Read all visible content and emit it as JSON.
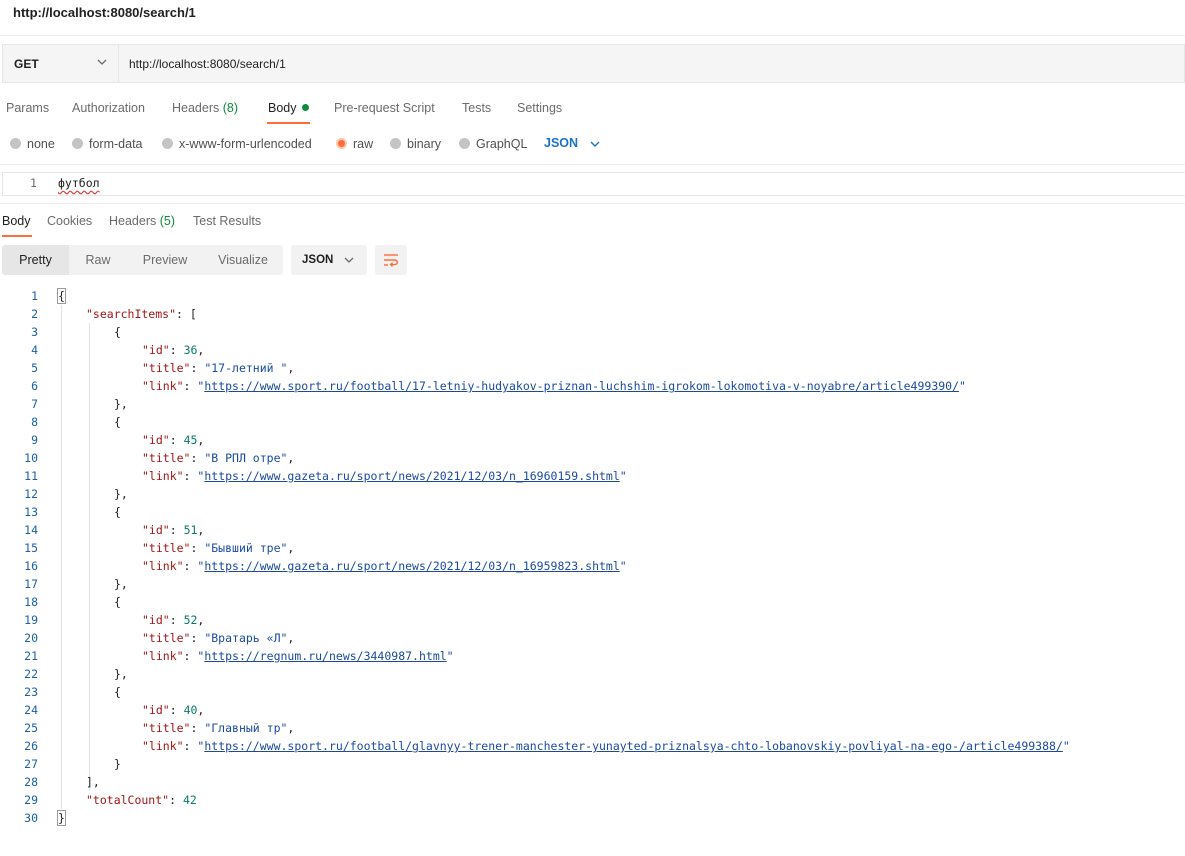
{
  "request": {
    "title": "http://localhost:8080/search/1",
    "method": "GET",
    "url": "http://localhost:8080/search/1"
  },
  "request_tabs": {
    "params": "Params",
    "authorization": "Authorization",
    "headers_label": "Headers",
    "headers_count": "(8)",
    "body": "Body",
    "pre_request": "Pre-request Script",
    "tests": "Tests",
    "settings": "Settings"
  },
  "body_types": {
    "none": "none",
    "form_data": "form-data",
    "urlencoded": "x-www-form-urlencoded",
    "raw": "raw",
    "binary": "binary",
    "graphql": "GraphQL",
    "selected_format": "JSON"
  },
  "request_body": {
    "line_number": "1",
    "text": "футбол"
  },
  "response_tabs": {
    "body": "Body",
    "cookies": "Cookies",
    "headers_label": "Headers",
    "headers_count": "(5)",
    "test_results": "Test Results"
  },
  "view_modes": {
    "pretty": "Pretty",
    "raw": "Raw",
    "preview": "Preview",
    "visualize": "Visualize",
    "format": "JSON"
  },
  "response": {
    "items": [
      {
        "id": "36",
        "title": "17-летний ",
        "link": "https://www.sport.ru/football/17-letniy-hudyakov-priznan-luchshim-igrokom-lokomotiva-v-noyabre/article499390/"
      },
      {
        "id": "45",
        "title": "В РПЛ отре",
        "link": "https://www.gazeta.ru/sport/news/2021/12/03/n_16960159.shtml"
      },
      {
        "id": "51",
        "title": "Бывший тре",
        "link": "https://www.gazeta.ru/sport/news/2021/12/03/n_16959823.shtml"
      },
      {
        "id": "52",
        "title": "Вратарь «Л",
        "link": "https://regnum.ru/news/3440987.html"
      },
      {
        "id": "40",
        "title": "Главный тр",
        "link": "https://www.sport.ru/football/glavnyy-trener-manchester-yunayted-priznalsya-chto-lobanovskiy-povliyal-na-ego-/article499388/"
      }
    ],
    "total_count": "42",
    "keys": {
      "search_items": "\"searchItems\"",
      "id": "\"id\"",
      "title": "\"title\"",
      "link": "\"link\"",
      "total_count": "\"totalCount\""
    }
  },
  "colors": {
    "accent": "#ff6c37",
    "count_green": "#0d8a3b",
    "link_blue": "#1a73c9"
  }
}
